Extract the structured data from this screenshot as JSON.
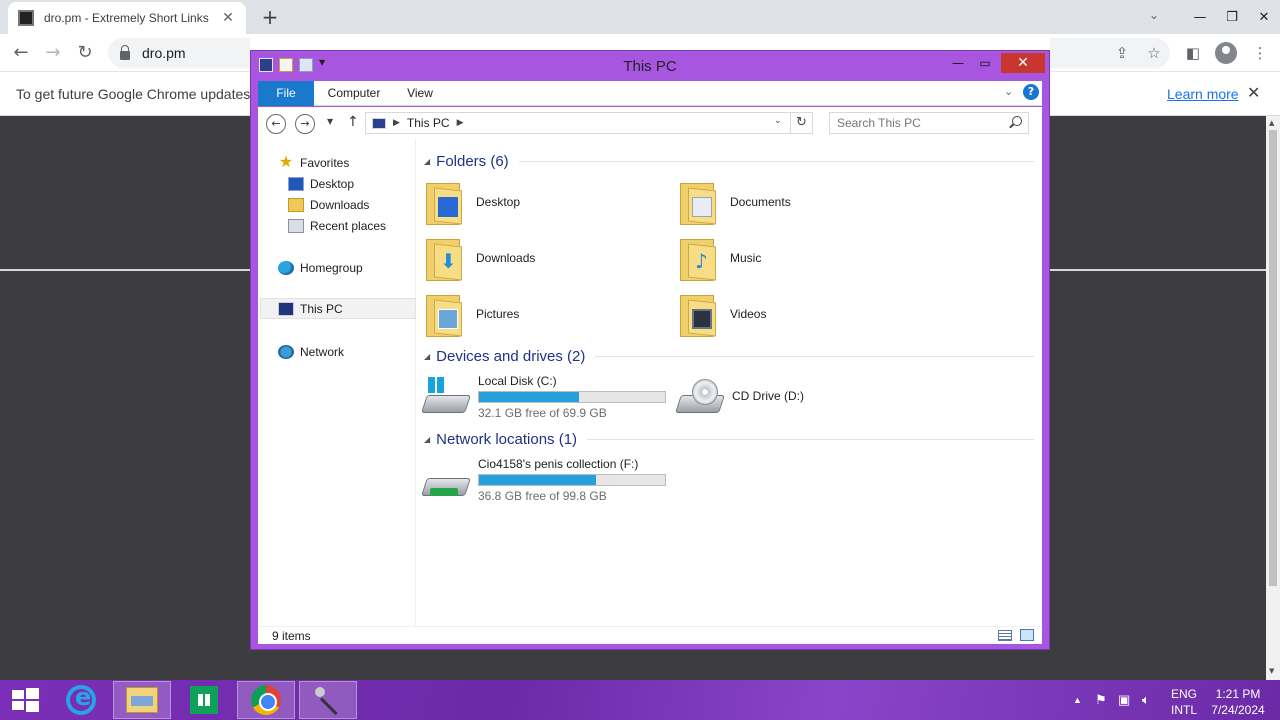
{
  "browser": {
    "tab_title": "dro.pm - Extremely Short Links",
    "url": "dro.pm",
    "infobar_text": "To get future Google Chrome updates, yo",
    "infobar_link": "Learn more"
  },
  "explorer": {
    "title": "This PC",
    "ribbon_tabs": [
      "File",
      "Computer",
      "View"
    ],
    "address": "This PC",
    "search_placeholder": "Search This PC",
    "nav_pane": {
      "favorites": "Favorites",
      "desktop": "Desktop",
      "downloads": "Downloads",
      "recent": "Recent places",
      "homegroup": "Homegroup",
      "this_pc": "This PC",
      "network": "Network"
    },
    "groups": {
      "folders": "Folders (6)",
      "devices": "Devices and drives (2)",
      "network": "Network locations (1)"
    },
    "folders": [
      {
        "name": "Desktop",
        "icon": "desktop-folder-icon"
      },
      {
        "name": "Documents",
        "icon": "documents-folder-icon"
      },
      {
        "name": "Downloads",
        "icon": "downloads-folder-icon"
      },
      {
        "name": "Music",
        "icon": "music-folder-icon"
      },
      {
        "name": "Pictures",
        "icon": "pictures-folder-icon"
      },
      {
        "name": "Videos",
        "icon": "videos-folder-icon"
      }
    ],
    "drives": [
      {
        "name": "Local Disk (C:)",
        "free": "32.1 GB free of 69.9 GB",
        "used_fraction": 0.54
      },
      {
        "name": "CD Drive (D:)"
      }
    ],
    "network_locations": [
      {
        "name": "Cio4158's penis collection (F:)",
        "free": "36.8 GB free of 99.8 GB",
        "used_fraction": 0.63
      }
    ],
    "status": "9 items"
  },
  "taskbar": {
    "lang_top": "ENG",
    "lang_bottom": "INTL",
    "time": "1:21 PM",
    "date": "7/24/2024"
  },
  "colors": {
    "accent": "#a855e0",
    "usage_bar": "#26a0da",
    "file_tab": "#1979ca",
    "close_button": "#c7372f"
  }
}
